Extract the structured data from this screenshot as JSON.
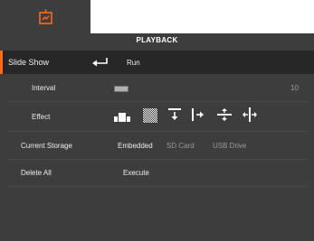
{
  "header": {
    "tab_icon": "presentation-icon",
    "title": "PLAYBACK"
  },
  "menu": {
    "slide_show": {
      "label": "Slide Show",
      "action_icon": "enter-return-icon",
      "action": "Run"
    },
    "interval": {
      "label": "Interval",
      "value": "10",
      "slider_icon": "slider-icon"
    },
    "effect": {
      "label": "Effect",
      "icons": [
        "bars-effect-icon",
        "dissolve-effect-icon",
        "wipe-down-icon",
        "wipe-right-icon",
        "split-vertical-icon",
        "split-horizontal-icon"
      ]
    },
    "current_storage": {
      "label": "Current Storage",
      "options": [
        "Embedded",
        "SD Card",
        "USB Drive"
      ],
      "selected": "Embedded"
    },
    "delete_all": {
      "label": "Delete All",
      "action": "Execute"
    }
  },
  "colors": {
    "accent": "#ff6a1a",
    "panel": "#3d3d3d",
    "selected_row": "#272727"
  }
}
